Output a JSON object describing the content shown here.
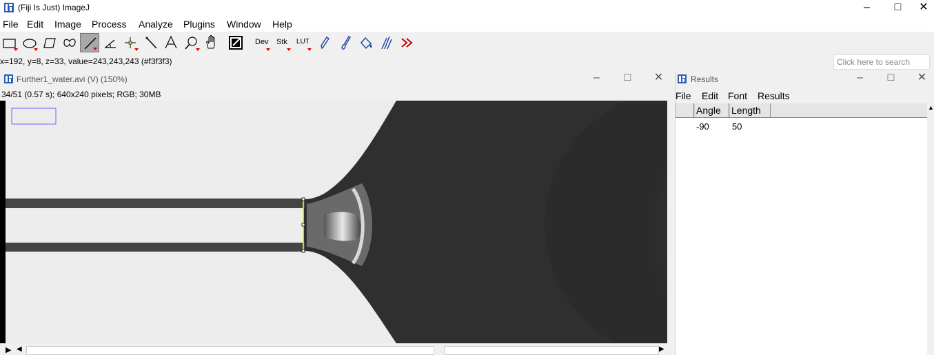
{
  "app": {
    "title": "(Fiji Is Just) ImageJ"
  },
  "menu": [
    "File",
    "Edit",
    "Image",
    "Process",
    "Analyze",
    "Plugins",
    "Window",
    "Help"
  ],
  "toolbar": {
    "tools": [
      "rectangle",
      "oval",
      "polygon",
      "freehand",
      "line",
      "angle",
      "point",
      "wand",
      "text",
      "magnifier",
      "hand",
      "color-picker"
    ],
    "dev_label": "Dev",
    "stk_label": "Stk",
    "lut_label": "LUT",
    "selected": "line"
  },
  "status": "x=192, y=8, z=33, value=243,243,243 (#f3f3f3)",
  "search": {
    "placeholder": "Click here to search"
  },
  "image_window": {
    "title": "Further1_water.avi (V) (150%)",
    "info": "34/51 (0.57 s); 640x240 pixels; RGB; 30MB"
  },
  "results_window": {
    "title": "Results",
    "menu": [
      "File",
      "Edit",
      "Font",
      "Results"
    ],
    "columns": [
      "Angle",
      "Length"
    ],
    "rows": [
      {
        "angle": "-90",
        "length": "50"
      }
    ]
  },
  "colors": {
    "selection_line": "#ffff00",
    "roi_box": "#6666ff",
    "accent_red": "#cc0000"
  }
}
